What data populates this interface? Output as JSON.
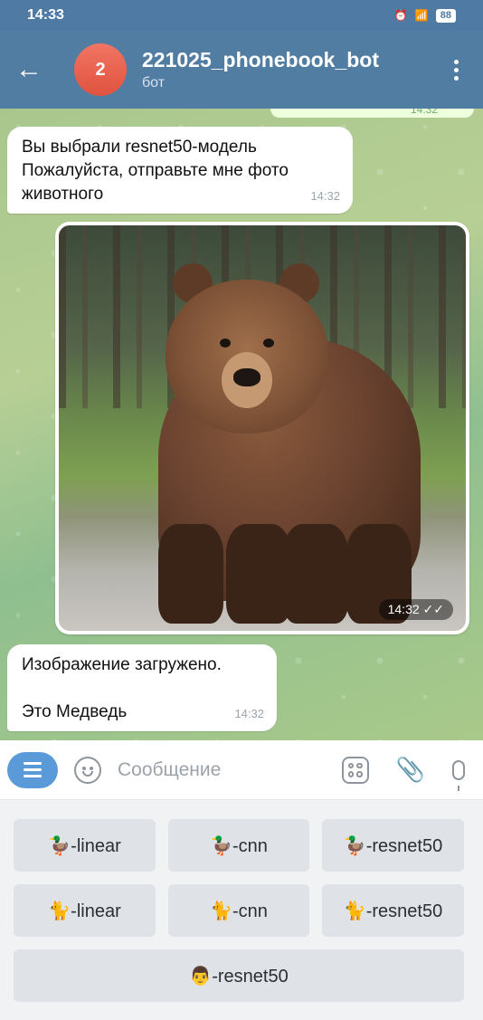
{
  "status_bar": {
    "time": "14:33",
    "battery": "88"
  },
  "header": {
    "avatar_letter": "2",
    "title": "221025_phonebook_bot",
    "subtitle": "бот"
  },
  "messages": {
    "top_out_time": "14:32",
    "msg1": {
      "line1": "Вы выбрали resnet50-модель",
      "line2": "Пожалуйста, отправьте мне фото",
      "line3": "животного",
      "time": "14:32"
    },
    "photo": {
      "time": "14:32 ✓✓"
    },
    "msg2": {
      "line1": "Изображение загружено.",
      "line2": "Это Медведь",
      "time": "14:32"
    }
  },
  "input": {
    "placeholder": "Сообщение"
  },
  "keyboard": {
    "row1": [
      "🦆-linear",
      "🦆-cnn",
      "🦆-resnet50"
    ],
    "row2": [
      "🐈-linear",
      "🐈-cnn",
      "🐈-resnet50"
    ],
    "row3": [
      "👨-resnet50"
    ]
  },
  "colors": {
    "header": "#527da3",
    "avatar": "#e85f4b",
    "menu_button": "#5a9ad8"
  }
}
